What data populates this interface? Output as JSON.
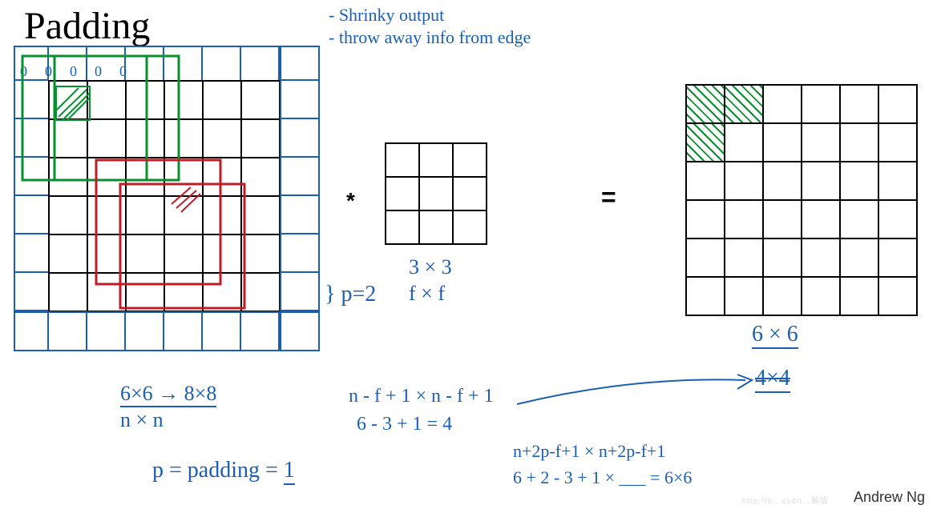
{
  "title": "Padding",
  "notes": {
    "bullet1": "- Shrinky output",
    "bullet2": "- throw away info from edge"
  },
  "grids": {
    "input": {
      "rows": 6,
      "cols": 6,
      "cell": 48
    },
    "filter": {
      "rows": 3,
      "cols": 3,
      "cell": 42
    },
    "output": {
      "rows": 6,
      "cols": 6,
      "cell": 48
    }
  },
  "operators": {
    "conv": "*",
    "equals": "="
  },
  "labels": {
    "filter_size": "3 × 3",
    "filter_var": "f × f",
    "padding_brace": "} p=2",
    "output_size": "6 × 6",
    "old_output": "4×4",
    "input_dims": "6×6 → 8×8",
    "input_var": "n × n",
    "padding_def": "p = padding = 1",
    "formula1": "n - f + 1  ×  n - f + 1",
    "formula1_calc": "6 - 3 + 1 = 4",
    "formula2": "n+2p-f+1  ×  n+2p-f+1",
    "formula2_calc": "6 + 2 - 3 + 1  ×  ___  = 6×6"
  },
  "author": "Andrew Ng",
  "watermark": "http://b...csdn...解版",
  "padding_cells": [
    "0",
    "0",
    "0",
    "0",
    "0"
  ]
}
